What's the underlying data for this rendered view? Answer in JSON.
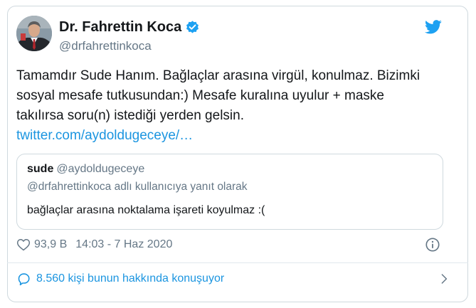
{
  "author": {
    "display_name": "Dr. Fahrettin Koca",
    "handle": "@drfahrettinkoca",
    "verified": true
  },
  "tweet": {
    "lines": [
      "Tamamdır Sude Hanım. Bağlaçlar arasına virgül, konulmaz. Bizimki",
      "sosyal mesafe tutkusundan:) Mesafe kuralına uyulur + maske",
      "takılırsa soru(n) istediği yerden gelsin."
    ],
    "link": "twitter.com/aydoldugeceye/…"
  },
  "quoted": {
    "name": "sude",
    "handle": "@aydoldugeceye",
    "reply_to": "@drfahrettinkoca adlı kullanıcıya yanıt olarak",
    "text": "bağlaçlar arasına noktalama işareti koyulmaz :("
  },
  "meta": {
    "likes": "93,9 B",
    "timestamp": "14:03 - 7 Haz 2020"
  },
  "footer": {
    "conversation": "8.560 kişi bunun hakkında konuşuyor"
  },
  "icons": {
    "verified": "verified-badge-icon",
    "brand": "twitter-bird-icon",
    "like": "heart-icon",
    "info": "info-icon",
    "reply": "speech-bubble-icon",
    "chevron": "chevron-right-icon"
  },
  "colors": {
    "link": "#1b95e0",
    "secondary_text": "#657786",
    "border": "#cfd9de"
  }
}
